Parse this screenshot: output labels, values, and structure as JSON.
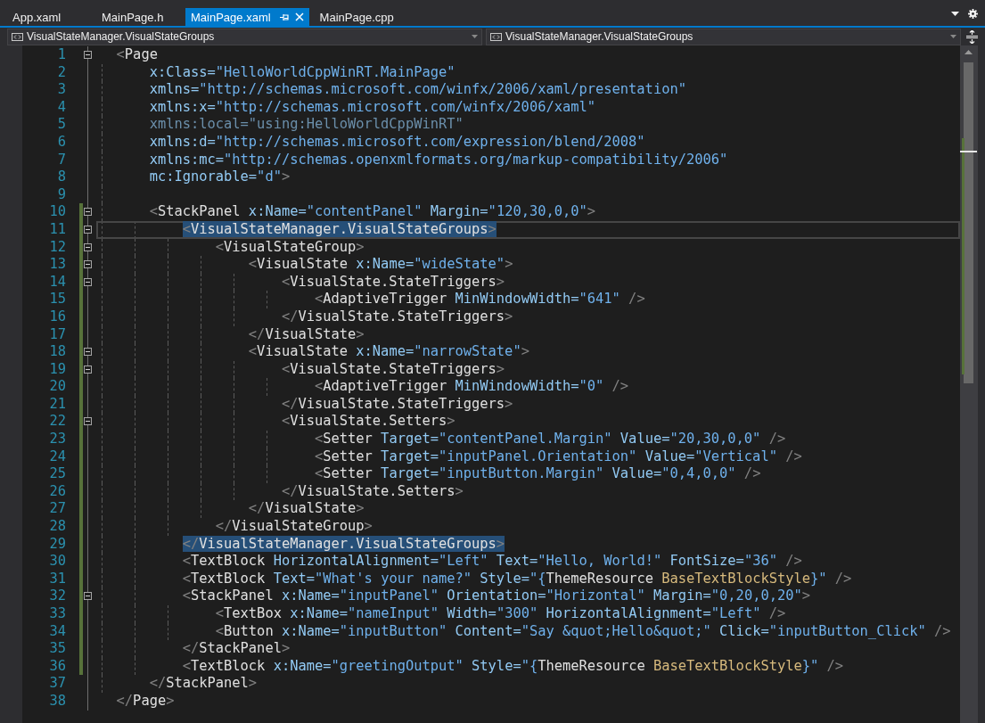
{
  "tabs": [
    {
      "label": "App.xaml",
      "selected": false
    },
    {
      "label": "MainPage.h",
      "selected": false
    },
    {
      "label": "MainPage.xaml",
      "selected": true
    },
    {
      "label": "MainPage.cpp",
      "selected": false
    }
  ],
  "navigation": {
    "scope_dropdown": "VisualStateManager.VisualStateGroups",
    "member_dropdown": "VisualStateManager.VisualStateGroups"
  },
  "lines": [
    {
      "number": "1",
      "changed": false,
      "fold": true,
      "highlighted": false,
      "current": false,
      "tokens": [
        {
          "kind": "delim",
          "text": "<"
        },
        {
          "kind": "element",
          "text": "Page"
        }
      ]
    },
    {
      "number": "2",
      "changed": false,
      "fold": false,
      "highlighted": false,
      "current": false,
      "tokens": [
        {
          "kind": "attr",
          "text": "    x:Class="
        },
        {
          "kind": "value",
          "text": "\"HelloWorldCppWinRT.MainPage\""
        }
      ]
    },
    {
      "number": "3",
      "changed": false,
      "fold": false,
      "highlighted": false,
      "current": false,
      "tokens": [
        {
          "kind": "attr",
          "text": "    xmlns="
        },
        {
          "kind": "value",
          "text": "\"http://schemas.microsoft.com/winfx/2006/xaml/presentation\""
        }
      ]
    },
    {
      "number": "4",
      "changed": false,
      "fold": false,
      "highlighted": false,
      "current": false,
      "tokens": [
        {
          "kind": "attr",
          "text": "    xmlns:x="
        },
        {
          "kind": "value",
          "text": "\"http://schemas.microsoft.com/winfx/2006/xaml\""
        }
      ]
    },
    {
      "number": "5",
      "changed": false,
      "fold": false,
      "highlighted": false,
      "current": false,
      "tokens": [
        {
          "kind": "unused",
          "text": "    xmlns:local=\"using:HelloWorldCppWinRT\""
        }
      ]
    },
    {
      "number": "6",
      "changed": false,
      "fold": false,
      "highlighted": false,
      "current": false,
      "tokens": [
        {
          "kind": "attr",
          "text": "    xmlns:d="
        },
        {
          "kind": "value",
          "text": "\"http://schemas.microsoft.com/expression/blend/2008\""
        }
      ]
    },
    {
      "number": "7",
      "changed": false,
      "fold": false,
      "highlighted": false,
      "current": false,
      "tokens": [
        {
          "kind": "attr",
          "text": "    xmlns:mc="
        },
        {
          "kind": "value",
          "text": "\"http://schemas.openxmlformats.org/markup-compatibility/2006\""
        }
      ]
    },
    {
      "number": "8",
      "changed": false,
      "fold": false,
      "highlighted": false,
      "current": false,
      "tokens": [
        {
          "kind": "attr",
          "text": "    mc:Ignorable="
        },
        {
          "kind": "value",
          "text": "\"d\""
        },
        {
          "kind": "delim",
          "text": ">"
        }
      ]
    },
    {
      "number": "9",
      "changed": false,
      "fold": false,
      "current": false
    },
    {
      "number": "10",
      "changed": true,
      "fold": true,
      "highlighted": false,
      "current": false,
      "tokens": [
        {
          "kind": "delim",
          "text": "    <"
        },
        {
          "kind": "element",
          "text": "StackPanel"
        },
        {
          "kind": "attr",
          "text": " x:Name="
        },
        {
          "kind": "value",
          "text": "\"contentPanel\""
        },
        {
          "kind": "attr",
          "text": " Margin="
        },
        {
          "kind": "value",
          "text": "\"120,30,0,0\""
        },
        {
          "kind": "delim",
          "text": ">"
        }
      ]
    },
    {
      "number": "11",
      "changed": true,
      "fold": true,
      "highlighted": true,
      "current": true,
      "tokens": [
        {
          "kind": "delim",
          "text": "        <"
        },
        {
          "kind": "element",
          "text": "VisualStateManager.VisualStateGroups"
        },
        {
          "kind": "delim",
          "text": ">"
        }
      ]
    },
    {
      "number": "12",
      "changed": true,
      "fold": true,
      "highlighted": false,
      "current": false,
      "tokens": [
        {
          "kind": "delim",
          "text": "            <"
        },
        {
          "kind": "element",
          "text": "VisualStateGroup"
        },
        {
          "kind": "delim",
          "text": ">"
        }
      ]
    },
    {
      "number": "13",
      "changed": true,
      "fold": true,
      "highlighted": false,
      "current": false,
      "tokens": [
        {
          "kind": "delim",
          "text": "                <"
        },
        {
          "kind": "element",
          "text": "VisualState"
        },
        {
          "kind": "attr",
          "text": " x:Name="
        },
        {
          "kind": "value",
          "text": "\"wideState\""
        },
        {
          "kind": "delim",
          "text": ">"
        }
      ]
    },
    {
      "number": "14",
      "changed": true,
      "fold": true,
      "highlighted": false,
      "current": false,
      "tokens": [
        {
          "kind": "delim",
          "text": "                    <"
        },
        {
          "kind": "element",
          "text": "VisualState.StateTriggers"
        },
        {
          "kind": "delim",
          "text": ">"
        }
      ]
    },
    {
      "number": "15",
      "changed": true,
      "fold": false,
      "highlighted": false,
      "current": false,
      "tokens": [
        {
          "kind": "delim",
          "text": "                        <"
        },
        {
          "kind": "element",
          "text": "AdaptiveTrigger"
        },
        {
          "kind": "attr",
          "text": " MinWindowWidth="
        },
        {
          "kind": "value",
          "text": "\"641\""
        },
        {
          "kind": "delim",
          "text": " />"
        }
      ]
    },
    {
      "number": "16",
      "changed": true,
      "fold": false,
      "highlighted": false,
      "current": false,
      "tokens": [
        {
          "kind": "delim",
          "text": "                    </"
        },
        {
          "kind": "element",
          "text": "VisualState.StateTriggers"
        },
        {
          "kind": "delim",
          "text": ">"
        }
      ]
    },
    {
      "number": "17",
      "changed": true,
      "fold": false,
      "highlighted": false,
      "current": false,
      "tokens": [
        {
          "kind": "delim",
          "text": "                </"
        },
        {
          "kind": "element",
          "text": "VisualState"
        },
        {
          "kind": "delim",
          "text": ">"
        }
      ]
    },
    {
      "number": "18",
      "changed": true,
      "fold": true,
      "highlighted": false,
      "current": false,
      "tokens": [
        {
          "kind": "delim",
          "text": "                <"
        },
        {
          "kind": "element",
          "text": "VisualState"
        },
        {
          "kind": "attr",
          "text": " x:Name="
        },
        {
          "kind": "value",
          "text": "\"narrowState\""
        },
        {
          "kind": "delim",
          "text": ">"
        }
      ]
    },
    {
      "number": "19",
      "changed": true,
      "fold": true,
      "highlighted": false,
      "current": false,
      "tokens": [
        {
          "kind": "delim",
          "text": "                    <"
        },
        {
          "kind": "element",
          "text": "VisualState.StateTriggers"
        },
        {
          "kind": "delim",
          "text": ">"
        }
      ]
    },
    {
      "number": "20",
      "changed": true,
      "fold": false,
      "highlighted": false,
      "current": false,
      "tokens": [
        {
          "kind": "delim",
          "text": "                        <"
        },
        {
          "kind": "element",
          "text": "AdaptiveTrigger"
        },
        {
          "kind": "attr",
          "text": " MinWindowWidth="
        },
        {
          "kind": "value",
          "text": "\"0\""
        },
        {
          "kind": "delim",
          "text": " />"
        }
      ]
    },
    {
      "number": "21",
      "changed": true,
      "fold": false,
      "highlighted": false,
      "current": false,
      "tokens": [
        {
          "kind": "delim",
          "text": "                    </"
        },
        {
          "kind": "element",
          "text": "VisualState.StateTriggers"
        },
        {
          "kind": "delim",
          "text": ">"
        }
      ]
    },
    {
      "number": "22",
      "changed": true,
      "fold": true,
      "highlighted": false,
      "current": false,
      "tokens": [
        {
          "kind": "delim",
          "text": "                    <"
        },
        {
          "kind": "element",
          "text": "VisualState.Setters"
        },
        {
          "kind": "delim",
          "text": ">"
        }
      ]
    },
    {
      "number": "23",
      "changed": true,
      "fold": false,
      "highlighted": false,
      "current": false,
      "tokens": [
        {
          "kind": "delim",
          "text": "                        <"
        },
        {
          "kind": "element",
          "text": "Setter"
        },
        {
          "kind": "attr",
          "text": " Target="
        },
        {
          "kind": "value",
          "text": "\"contentPanel.Margin\""
        },
        {
          "kind": "attr",
          "text": " Value="
        },
        {
          "kind": "value",
          "text": "\"20,30,0,0\""
        },
        {
          "kind": "delim",
          "text": " />"
        }
      ]
    },
    {
      "number": "24",
      "changed": true,
      "fold": false,
      "highlighted": false,
      "current": false,
      "tokens": [
        {
          "kind": "delim",
          "text": "                        <"
        },
        {
          "kind": "element",
          "text": "Setter"
        },
        {
          "kind": "attr",
          "text": " Target="
        },
        {
          "kind": "value",
          "text": "\"inputPanel.Orientation\""
        },
        {
          "kind": "attr",
          "text": " Value="
        },
        {
          "kind": "value",
          "text": "\"Vertical\""
        },
        {
          "kind": "delim",
          "text": " />"
        }
      ]
    },
    {
      "number": "25",
      "changed": true,
      "fold": false,
      "highlighted": false,
      "current": false,
      "tokens": [
        {
          "kind": "delim",
          "text": "                        <"
        },
        {
          "kind": "element",
          "text": "Setter"
        },
        {
          "kind": "attr",
          "text": " Target="
        },
        {
          "kind": "value",
          "text": "\"inputButton.Margin\""
        },
        {
          "kind": "attr",
          "text": " Value="
        },
        {
          "kind": "value",
          "text": "\"0,4,0,0\""
        },
        {
          "kind": "delim",
          "text": " />"
        }
      ]
    },
    {
      "number": "26",
      "changed": true,
      "fold": false,
      "highlighted": false,
      "current": false,
      "tokens": [
        {
          "kind": "delim",
          "text": "                    </"
        },
        {
          "kind": "element",
          "text": "VisualState.Setters"
        },
        {
          "kind": "delim",
          "text": ">"
        }
      ]
    },
    {
      "number": "27",
      "changed": true,
      "fold": false,
      "highlighted": false,
      "current": false,
      "tokens": [
        {
          "kind": "delim",
          "text": "                </"
        },
        {
          "kind": "element",
          "text": "VisualState"
        },
        {
          "kind": "delim",
          "text": ">"
        }
      ]
    },
    {
      "number": "28",
      "changed": true,
      "fold": false,
      "highlighted": false,
      "current": false,
      "tokens": [
        {
          "kind": "delim",
          "text": "            </"
        },
        {
          "kind": "element",
          "text": "VisualStateGroup"
        },
        {
          "kind": "delim",
          "text": ">"
        }
      ]
    },
    {
      "number": "29",
      "changed": true,
      "fold": false,
      "highlighted": true,
      "current": false,
      "tokens": [
        {
          "kind": "delim",
          "text": "        </"
        },
        {
          "kind": "element",
          "text": "VisualStateManager.VisualStateGroups"
        },
        {
          "kind": "delim",
          "text": ">"
        }
      ]
    },
    {
      "number": "30",
      "changed": true,
      "fold": false,
      "highlighted": false,
      "current": false,
      "tokens": [
        {
          "kind": "delim",
          "text": "        <"
        },
        {
          "kind": "element",
          "text": "TextBlock"
        },
        {
          "kind": "attr",
          "text": " HorizontalAlignment="
        },
        {
          "kind": "value",
          "text": "\"Left\""
        },
        {
          "kind": "attr",
          "text": " Text="
        },
        {
          "kind": "value",
          "text": "\"Hello, World!\""
        },
        {
          "kind": "attr",
          "text": " FontSize="
        },
        {
          "kind": "value",
          "text": "\"36\""
        },
        {
          "kind": "delim",
          "text": " />"
        }
      ]
    },
    {
      "number": "31",
      "changed": true,
      "fold": false,
      "highlighted": false,
      "current": false,
      "tokens": [
        {
          "kind": "delim",
          "text": "        <"
        },
        {
          "kind": "element",
          "text": "TextBlock"
        },
        {
          "kind": "attr",
          "text": " Text="
        },
        {
          "kind": "value",
          "text": "\"What's your name?\""
        },
        {
          "kind": "attr",
          "text": " Style="
        },
        {
          "kind": "value",
          "text": "\"{"
        },
        {
          "kind": "keyword",
          "text": "ThemeResource "
        },
        {
          "kind": "resource",
          "text": "BaseTextBlockStyle"
        },
        {
          "kind": "value",
          "text": "}\""
        },
        {
          "kind": "delim",
          "text": " />"
        }
      ]
    },
    {
      "number": "32",
      "changed": true,
      "fold": true,
      "highlighted": false,
      "current": false,
      "tokens": [
        {
          "kind": "delim",
          "text": "        <"
        },
        {
          "kind": "element",
          "text": "StackPanel"
        },
        {
          "kind": "attr",
          "text": " x:Name="
        },
        {
          "kind": "value",
          "text": "\"inputPanel\""
        },
        {
          "kind": "attr",
          "text": " Orientation="
        },
        {
          "kind": "value",
          "text": "\"Horizontal\""
        },
        {
          "kind": "attr",
          "text": " Margin="
        },
        {
          "kind": "value",
          "text": "\"0,20,0,20\""
        },
        {
          "kind": "delim",
          "text": ">"
        }
      ]
    },
    {
      "number": "33",
      "changed": true,
      "fold": false,
      "highlighted": false,
      "current": false,
      "tokens": [
        {
          "kind": "delim",
          "text": "            <"
        },
        {
          "kind": "element",
          "text": "TextBox"
        },
        {
          "kind": "attr",
          "text": " x:Name="
        },
        {
          "kind": "value",
          "text": "\"nameInput\""
        },
        {
          "kind": "attr",
          "text": " Width="
        },
        {
          "kind": "value",
          "text": "\"300\""
        },
        {
          "kind": "attr",
          "text": " HorizontalAlignment="
        },
        {
          "kind": "value",
          "text": "\"Left\""
        },
        {
          "kind": "delim",
          "text": " />"
        }
      ]
    },
    {
      "number": "34",
      "changed": true,
      "fold": false,
      "highlighted": false,
      "current": false,
      "tokens": [
        {
          "kind": "delim",
          "text": "            <"
        },
        {
          "kind": "element",
          "text": "Button"
        },
        {
          "kind": "attr",
          "text": " x:Name="
        },
        {
          "kind": "value",
          "text": "\"inputButton\""
        },
        {
          "kind": "attr",
          "text": " Content="
        },
        {
          "kind": "value",
          "text": "\"Say &quot;Hello&quot;\""
        },
        {
          "kind": "attr",
          "text": " Click="
        },
        {
          "kind": "value",
          "text": "\"inputButton_Click\""
        },
        {
          "kind": "delim",
          "text": " />"
        }
      ]
    },
    {
      "number": "35",
      "changed": true,
      "fold": false,
      "highlighted": false,
      "current": false,
      "tokens": [
        {
          "kind": "delim",
          "text": "        </"
        },
        {
          "kind": "element",
          "text": "StackPanel"
        },
        {
          "kind": "delim",
          "text": ">"
        }
      ]
    },
    {
      "number": "36",
      "changed": true,
      "fold": false,
      "highlighted": false,
      "current": false,
      "tokens": [
        {
          "kind": "delim",
          "text": "        <"
        },
        {
          "kind": "element",
          "text": "TextBlock"
        },
        {
          "kind": "attr",
          "text": " x:Name="
        },
        {
          "kind": "value",
          "text": "\"greetingOutput\""
        },
        {
          "kind": "attr",
          "text": " Style="
        },
        {
          "kind": "value",
          "text": "\"{"
        },
        {
          "kind": "keyword",
          "text": "ThemeResource "
        },
        {
          "kind": "resource",
          "text": "BaseTextBlockStyle"
        },
        {
          "kind": "value",
          "text": "}\""
        },
        {
          "kind": "delim",
          "text": " />"
        }
      ]
    },
    {
      "number": "37",
      "changed": false,
      "fold": false,
      "highlighted": false,
      "current": false,
      "tokens": [
        {
          "kind": "delim",
          "text": "    </"
        },
        {
          "kind": "element",
          "text": "StackPanel"
        },
        {
          "kind": "delim",
          "text": ">"
        }
      ]
    },
    {
      "number": "38",
      "changed": false,
      "fold": false,
      "highlighted": false,
      "current": false,
      "tokens": [
        {
          "kind": "delim",
          "text": "</"
        },
        {
          "kind": "element",
          "text": "Page"
        },
        {
          "kind": "delim",
          "text": ">"
        }
      ]
    }
  ]
}
